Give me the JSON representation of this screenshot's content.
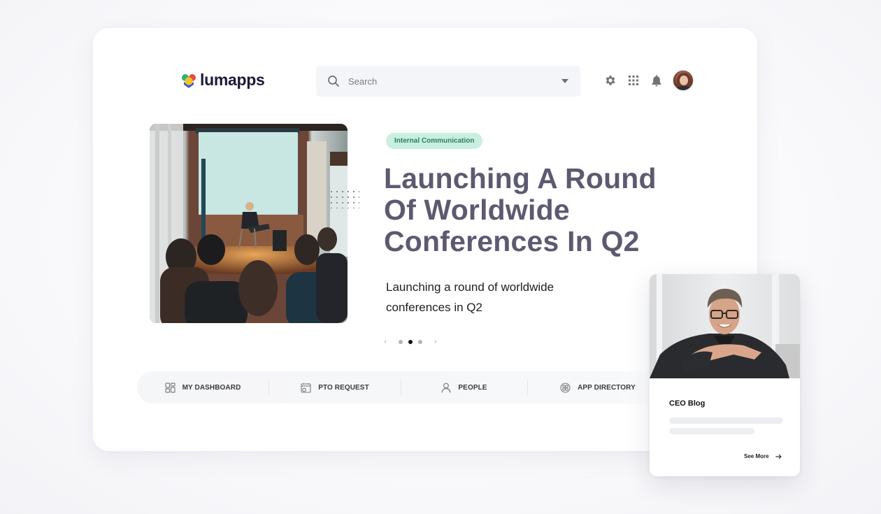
{
  "header": {
    "brand": "lumapps",
    "search": {
      "placeholder": "Search",
      "value": ""
    },
    "icons": [
      "settings-icon",
      "apps-grid-icon",
      "notifications-icon",
      "user-avatar"
    ]
  },
  "hero": {
    "tag": "Internal Communication",
    "headline": "Launching A Round Of Worldwide Conferences In Q2",
    "description": "Launching a round of worldwide conferences in Q2",
    "carousel": {
      "prev": "‹",
      "next": "›",
      "total": 3,
      "active_index": 1
    }
  },
  "quick_nav": {
    "items": [
      {
        "label": "MY DASHBOARD",
        "icon": "dashboard-icon"
      },
      {
        "label": "PTO REQUEST",
        "icon": "calendar-request-icon"
      },
      {
        "label": "PEOPLE",
        "icon": "person-icon"
      },
      {
        "label": "APP DIRECTORY",
        "icon": "app-directory-icon"
      }
    ]
  },
  "ceo_card": {
    "title": "CEO Blog",
    "link": "See More"
  },
  "colors": {
    "tag_bg": "#c9efe0",
    "tag_text": "#2f7d62",
    "headline": "#5c5a70",
    "brand_text": "#1c1a3a"
  }
}
